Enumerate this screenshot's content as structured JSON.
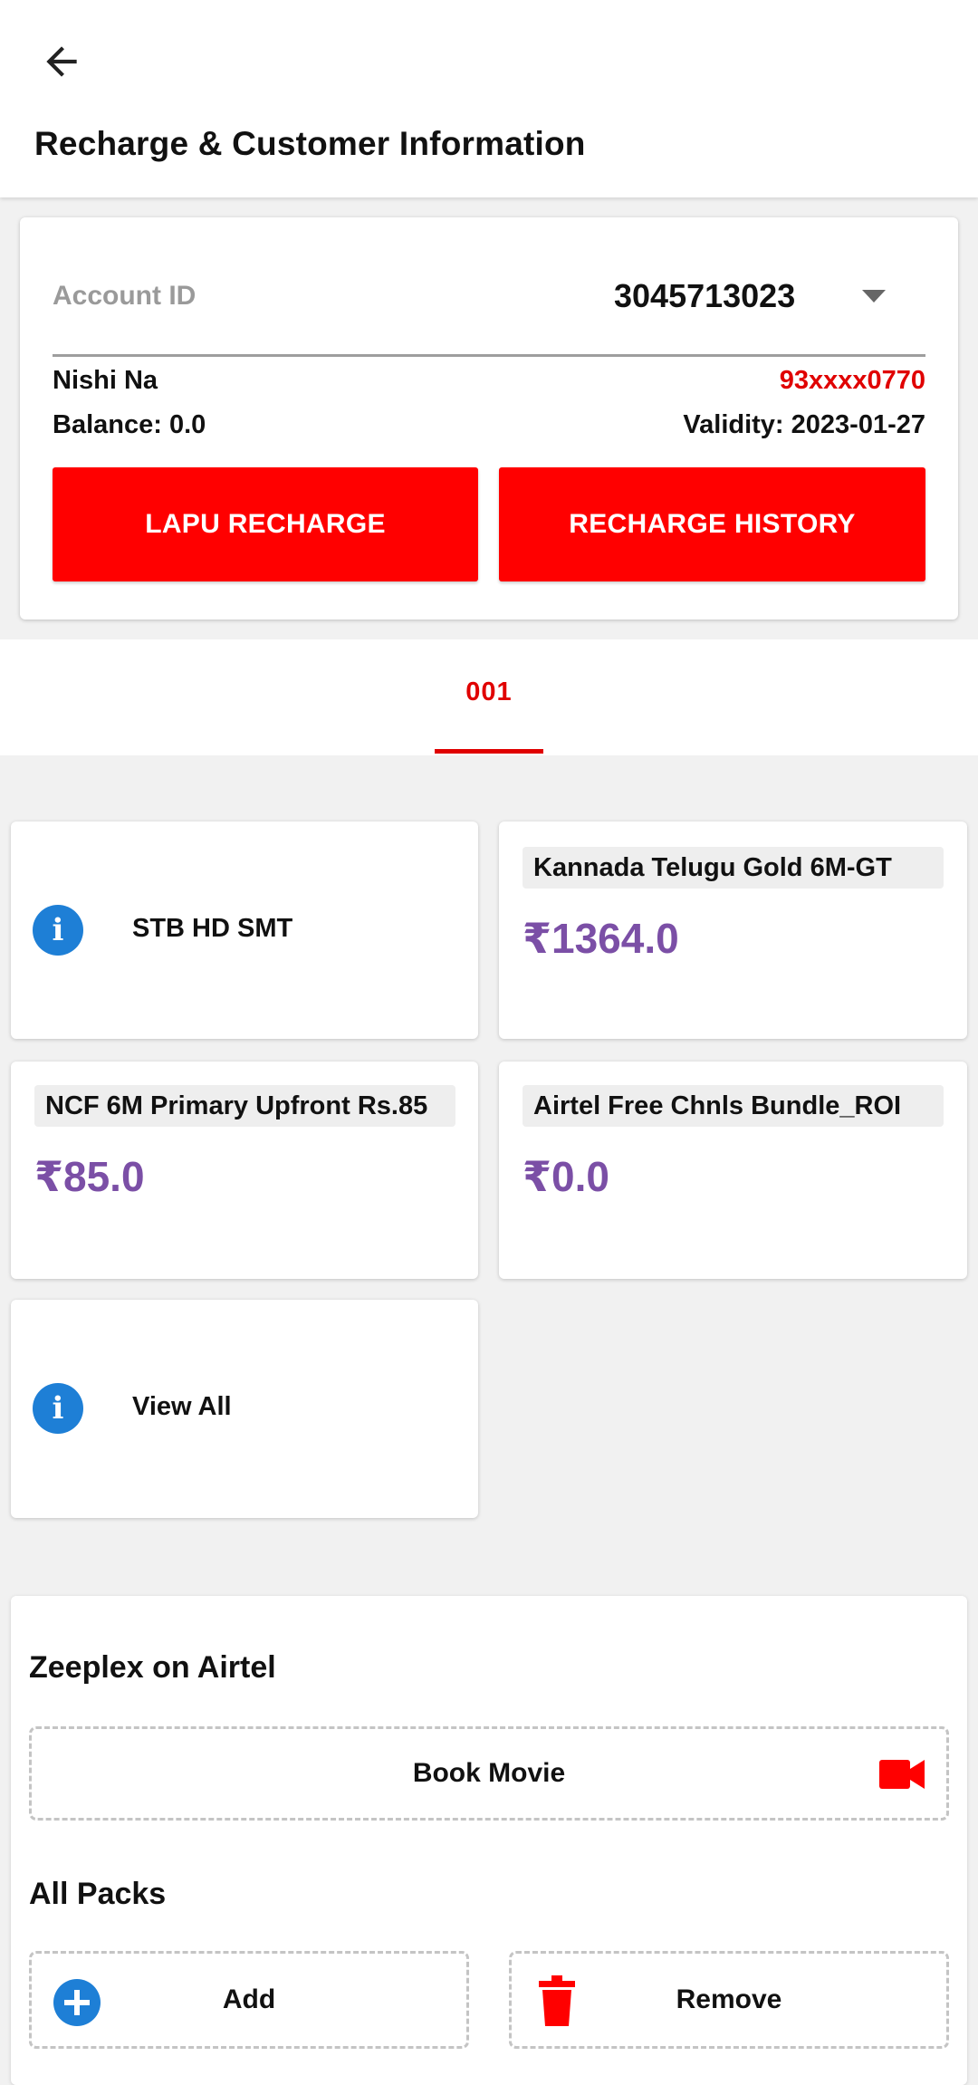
{
  "header": {
    "title": "Recharge & Customer Information"
  },
  "account": {
    "label": "Account ID",
    "id": "3045713023",
    "name": "Nishi Na",
    "phone": "93xxxx0770",
    "balance": "Balance: 0.0",
    "validity": "Validity: 2023-01-27",
    "buttons": {
      "lapu": "LAPU RECHARGE",
      "history": "RECHARGE HISTORY"
    }
  },
  "tabs": [
    {
      "label": "001",
      "selected": true
    }
  ],
  "packs": {
    "stb": {
      "label": "STB HD SMT"
    },
    "cards": [
      {
        "name": "Kannada Telugu Gold 6M-GT",
        "price": "₹1364.0"
      },
      {
        "name": "NCF 6M Primary Upfront Rs.85",
        "price": "₹85.0"
      },
      {
        "name": "Airtel Free Chnls Bundle_ROI",
        "price": "₹0.0"
      }
    ],
    "view_all": "View All"
  },
  "zeeplex": {
    "title": "Zeeplex on Airtel",
    "book_movie": "Book Movie"
  },
  "all_packs": {
    "title": "All Packs",
    "add": "Add",
    "remove": "Remove"
  },
  "colors": {
    "accent": "#ff0000",
    "price": "#7b4fa6",
    "info": "#1e7fd6"
  },
  "icons": [
    "back-arrow-icon",
    "dropdown-caret-icon",
    "info-icon",
    "video-camera-icon",
    "add-circle-icon",
    "trash-icon"
  ]
}
